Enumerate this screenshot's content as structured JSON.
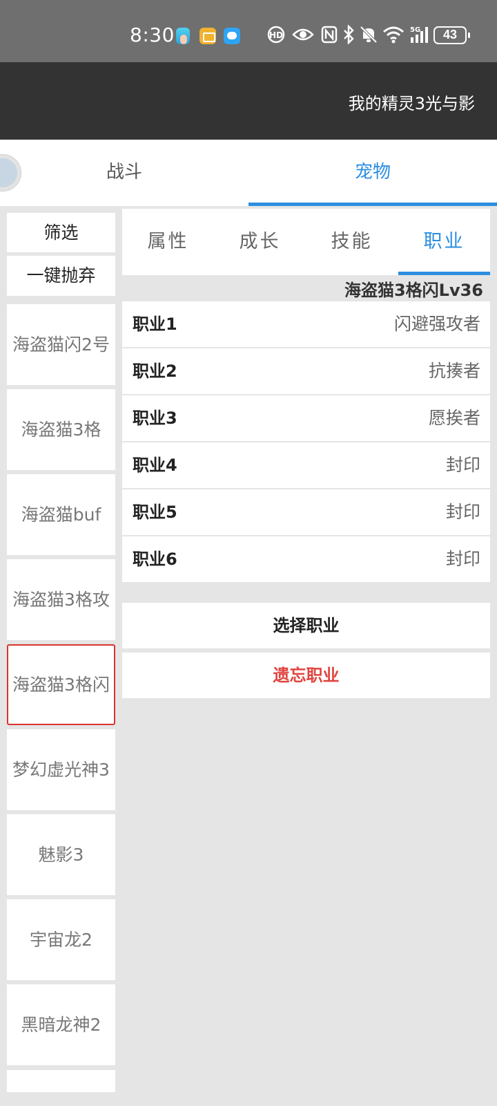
{
  "status_bar": {
    "time": "8:30",
    "network": "5G",
    "battery": "43",
    "icons": [
      "app-notification-icon",
      "mail-icon",
      "message-icon",
      "hd-icon",
      "eye-icon",
      "nfc-icon",
      "bluetooth-icon",
      "mute-icon",
      "wifi-icon",
      "signal-icon",
      "battery-icon"
    ]
  },
  "app_bar": {
    "title": "我的精灵3光与影"
  },
  "top_tabs": [
    {
      "label": "战斗",
      "active": false
    },
    {
      "label": "宠物",
      "active": true
    }
  ],
  "sidebar": {
    "filter_label": "筛选",
    "discard_label": "一键抛弃",
    "pets": [
      {
        "name": "海盗猫闪2号",
        "selected": false
      },
      {
        "name": "海盗猫3格",
        "selected": false
      },
      {
        "name": "海盗猫buf",
        "selected": false
      },
      {
        "name": "海盗猫3格攻",
        "selected": false
      },
      {
        "name": "海盗猫3格闪",
        "selected": true
      },
      {
        "name": "梦幻虚光神3",
        "selected": false
      },
      {
        "name": "魅影3",
        "selected": false
      },
      {
        "name": "宇宙龙2",
        "selected": false
      },
      {
        "name": "黑暗龙神2",
        "selected": false
      },
      {
        "name": "",
        "selected": false
      }
    ]
  },
  "sub_tabs": [
    {
      "label": "属性",
      "active": false
    },
    {
      "label": "成长",
      "active": false
    },
    {
      "label": "技能",
      "active": false
    },
    {
      "label": "职业",
      "active": true
    }
  ],
  "pet_header": "海盗猫3格闪Lv36",
  "jobs": [
    {
      "label": "职业1",
      "value": "闪避强攻者"
    },
    {
      "label": "职业2",
      "value": "抗揍者"
    },
    {
      "label": "职业3",
      "value": "愿挨者"
    },
    {
      "label": "职业4",
      "value": "封印"
    },
    {
      "label": "职业5",
      "value": "封印"
    },
    {
      "label": "职业6",
      "value": "封印"
    }
  ],
  "actions": {
    "choose_job": "选择职业",
    "forget_job": "遗忘职业"
  },
  "colors": {
    "accent": "#2b8ee0",
    "danger": "#e0443f",
    "app_bar": "#333333",
    "status_bar": "#6f6f6f",
    "background": "#e5e5e5"
  }
}
